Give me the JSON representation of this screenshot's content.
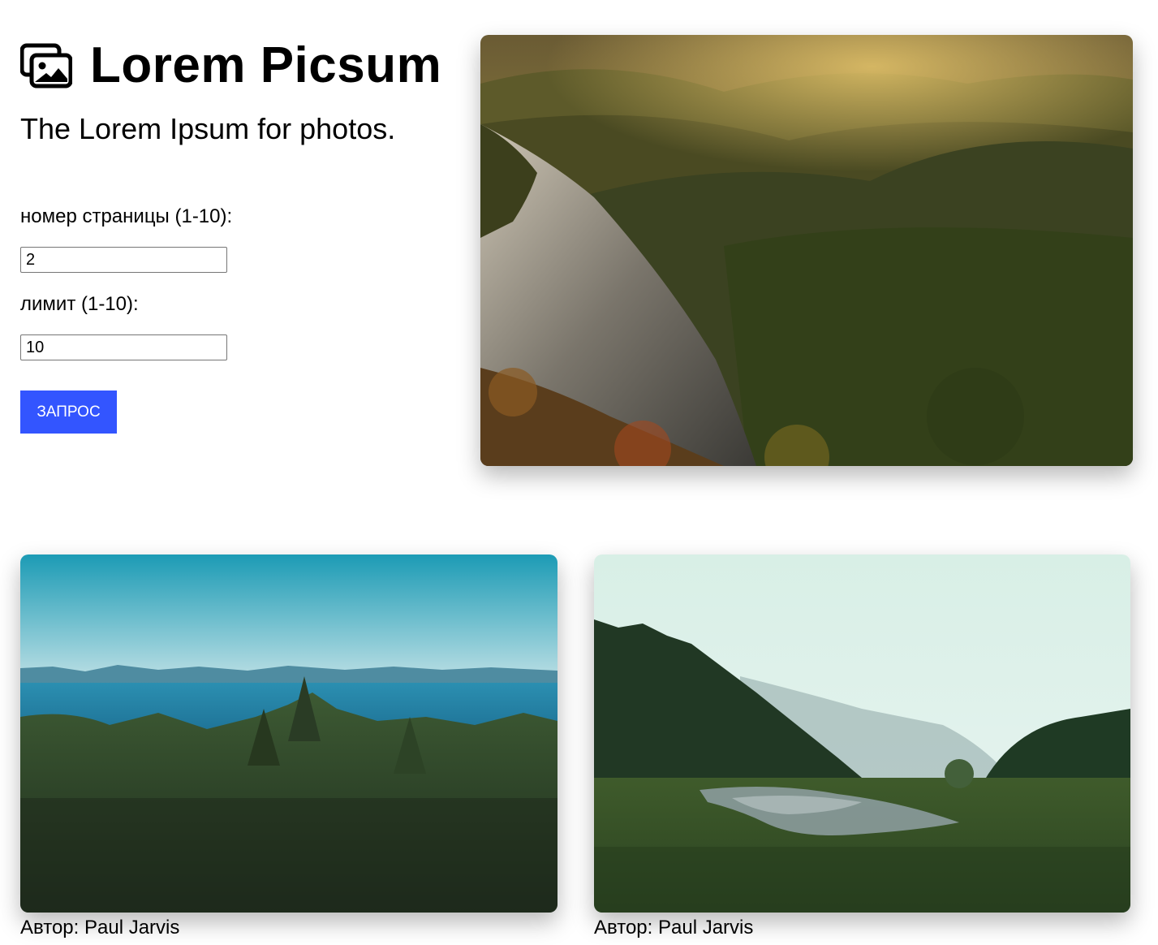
{
  "header": {
    "icon": "images-icon",
    "title": "Lorem Picsum",
    "tagline": "The Lorem Ipsum for photos."
  },
  "form": {
    "page_label": "номер страницы (1-10):",
    "page_value": "2",
    "limit_label": "лимит (1-10):",
    "limit_value": "10",
    "submit_label": "ЗАПРОС",
    "accent_color": "#3355ff"
  },
  "gallery": {
    "featured": {
      "description": "mountain valley with rocky slope at sunset"
    },
    "items": [
      {
        "author_label": "Автор: Paul Jarvis",
        "description": "pine forest with sea and distant mountains"
      },
      {
        "author_label": "Автор: Paul Jarvis",
        "description": "river meadow in a misty forested valley"
      }
    ]
  }
}
